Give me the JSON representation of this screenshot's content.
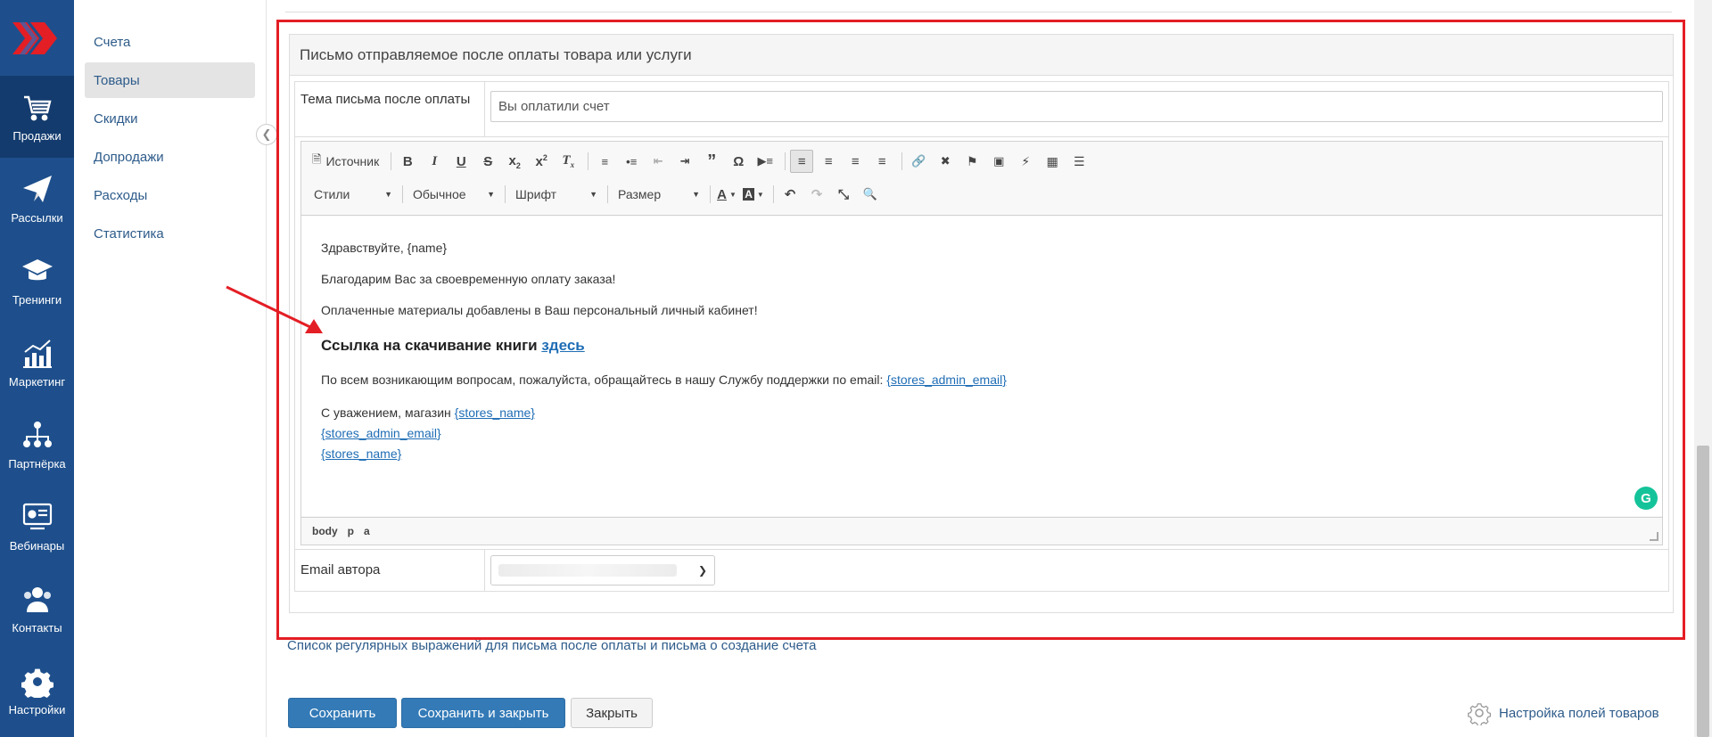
{
  "nav": {
    "items": [
      {
        "label": "Продажи",
        "icon": "cart-icon"
      },
      {
        "label": "Рассылки",
        "icon": "paper-plane-icon"
      },
      {
        "label": "Тренинги",
        "icon": "graduation-cap-icon"
      },
      {
        "label": "Маркетинг",
        "icon": "bar-chart-icon"
      },
      {
        "label": "Партнёрка",
        "icon": "network-icon"
      },
      {
        "label": "Вебинары",
        "icon": "webinar-icon"
      },
      {
        "label": "Контакты",
        "icon": "users-icon"
      },
      {
        "label": "Настройки",
        "icon": "gear-icon"
      }
    ]
  },
  "subnav": {
    "items": [
      {
        "label": "Счета"
      },
      {
        "label": "Товары"
      },
      {
        "label": "Скидки"
      },
      {
        "label": "Допродажи"
      },
      {
        "label": "Расходы"
      },
      {
        "label": "Статистика"
      }
    ]
  },
  "panel": {
    "title": "Письмо отправляемое после оплаты товара или услуги",
    "subject_label": "Тема письма после оплаты",
    "subject_value": "Вы оплатили счет",
    "email_label": "Email автора"
  },
  "toolbar": {
    "source": "Источник",
    "styles": "Стили",
    "format": "Обычное",
    "font": "Шрифт",
    "size": "Размер"
  },
  "content": {
    "greeting": "Здравствуйте, {name}",
    "thanks": "Благодарим Вас за своевременную оплату заказа!",
    "materials": "Оплаченные материалы добавлены в Ваш персональный личный кабинет!",
    "download_text": "Ссылка на скачивание книги ",
    "download_link": "здесь",
    "support_text": "По всем возникающим вопросам, пожалуйста, обращайтесь в нашу Службу поддержки по email: ",
    "support_link": "{stores_admin_email}",
    "regards_text": "С уважением, магазин ",
    "regards_link": "{stores_name}",
    "sig_email": "{stores_admin_email}",
    "sig_name": "{stores_name}"
  },
  "statusbar": {
    "path": [
      "body",
      "p",
      "a"
    ]
  },
  "footer": {
    "regex_link": "Список регулярных выражений для письма после оплаты и письма о создание счета",
    "save": "Сохранить",
    "save_close": "Сохранить и закрыть",
    "close": "Закрыть",
    "settings": "Настройка полей товаров"
  },
  "colors": {
    "nav_bg": "#1e4f8c",
    "nav_active": "#133b6e",
    "primary": "#337ab7",
    "highlight_frame": "#e41e25",
    "link": "#1f6db5"
  }
}
